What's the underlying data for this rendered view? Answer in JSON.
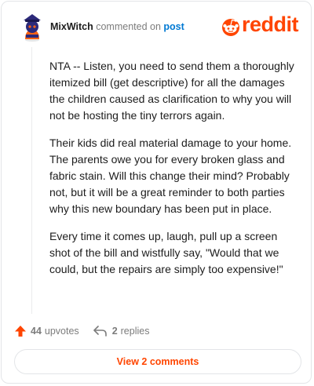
{
  "comment": {
    "username": "MixWitch",
    "action_text": "commented on",
    "target_link": "post",
    "paragraphs": [
      "NTA -- Listen, you need to send them a thoroughly itemized bill (get descriptive) for all the damages the children caused as clarification to why you will not be hosting the tiny terrors again.",
      "Their kids did real material damage to your home. The parents owe you for every broken glass and fabric stain. Will this change their mind? Probably not, but it will be a great reminder to both parties why this new boundary has been put in place.",
      "Every time it comes up, laugh, pull up a screen shot of the bill and wistfully say, \"Would that we could, but the repairs are simply too expensive!\""
    ]
  },
  "brand": {
    "name": "reddit",
    "icon": "reddit-alien-icon",
    "color": "#ff4500"
  },
  "actions": {
    "upvote_count": "44",
    "upvote_label": "upvotes",
    "upvote_icon": "upvote-arrow-icon",
    "reply_count": "2",
    "reply_label": "replies",
    "reply_icon": "reply-arrow-icon"
  },
  "view_comments": {
    "label": "View 2 comments"
  },
  "avatar": {
    "icon": "snoo-avatar-icon",
    "colors": [
      "#2c2a7a",
      "#ff6314"
    ]
  },
  "colors": {
    "accent": "#ff4500",
    "link": "#0079d3",
    "text": "#1c1c1c",
    "muted": "#7c7c7c",
    "border": "#e3e5e8"
  }
}
